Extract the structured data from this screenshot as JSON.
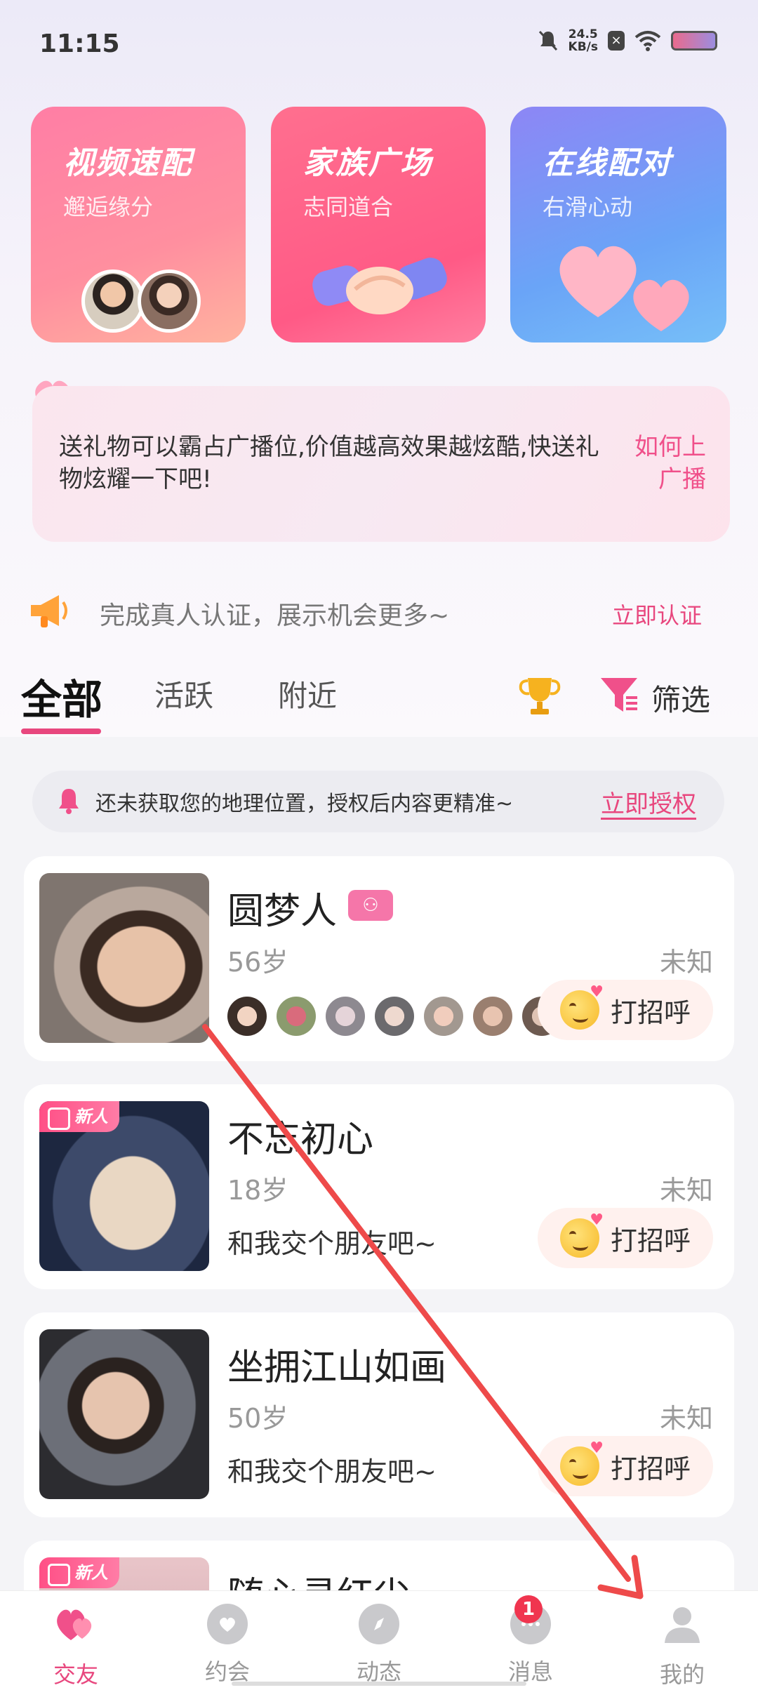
{
  "status_bar": {
    "time": "11:15",
    "speed_value": "24.5",
    "speed_unit": "KB/s"
  },
  "feature_cards": [
    {
      "title": "视频速配",
      "subtitle": "邂逅缘分"
    },
    {
      "title": "家族广场",
      "subtitle": "志同道合"
    },
    {
      "title": "在线配对",
      "subtitle": "右滑心动"
    }
  ],
  "broadcast": {
    "text": "送礼物可以霸占广播位,价值越高效果越炫酷,快送礼物炫耀一下吧!",
    "link": "如何上广播"
  },
  "verify": {
    "text": "完成真人认证，展示机会更多~",
    "link": "立即认证"
  },
  "tabs": {
    "all": "全部",
    "active": "活跃",
    "nearby": "附近",
    "filter": "筛选"
  },
  "location_banner": {
    "text": "还未获取您的地理位置，授权后内容更精准~",
    "link": "立即授权"
  },
  "users": [
    {
      "name": "圆梦人",
      "age": "56岁",
      "distance": "未知",
      "greet": "打招呼"
    },
    {
      "name": "不忘初心",
      "age": "18岁",
      "distance": "未知",
      "bio": "和我交个朋友吧~",
      "greet": "打招呼",
      "badge": "新人"
    },
    {
      "name": "坐拥江山如画",
      "age": "50岁",
      "distance": "未知",
      "bio": "和我交个朋友吧~",
      "greet": "打招呼"
    },
    {
      "name": "随心寻红尘",
      "badge": "新人"
    }
  ],
  "bottom_nav": [
    {
      "label": "交友"
    },
    {
      "label": "约会"
    },
    {
      "label": "动态"
    },
    {
      "label": "消息",
      "badge": "1"
    },
    {
      "label": "我的"
    }
  ],
  "colors": {
    "accent": "#e8477e",
    "arrow": "#ee4a4a"
  }
}
